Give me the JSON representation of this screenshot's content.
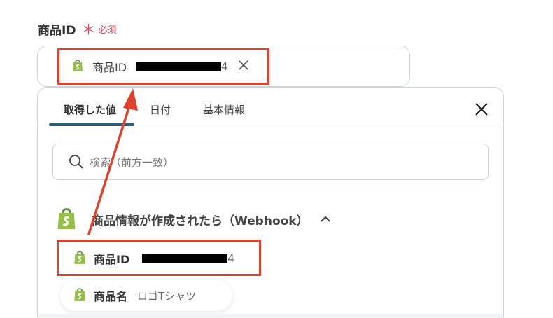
{
  "field": {
    "label": "商品ID",
    "required_mark": "＊",
    "required_text": "必須"
  },
  "selected_chip": {
    "label": "商品ID",
    "value_suffix": "4"
  },
  "tabs": [
    {
      "label": "取得した値",
      "active": true
    },
    {
      "label": "日付",
      "active": false
    },
    {
      "label": "基本情報",
      "active": false
    }
  ],
  "search": {
    "placeholder": "検索（前方一致）"
  },
  "group": {
    "title": "商品情報が作成されたら（Webhook）"
  },
  "items": [
    {
      "label": "商品ID",
      "value_suffix": "4"
    },
    {
      "label": "商品名",
      "value": "ロゴTシャツ"
    }
  ],
  "colors": {
    "highlight": "#e0412d",
    "required": "#e4455e",
    "tab_underline": "#2e5f78",
    "shopify_green": "#95bf47"
  },
  "icons": {
    "chip_icon": "shopify-bag-icon",
    "remove": "close-icon",
    "dropdown_close": "close-icon",
    "search": "search-icon",
    "group_toggle": "chevron-up-icon"
  }
}
